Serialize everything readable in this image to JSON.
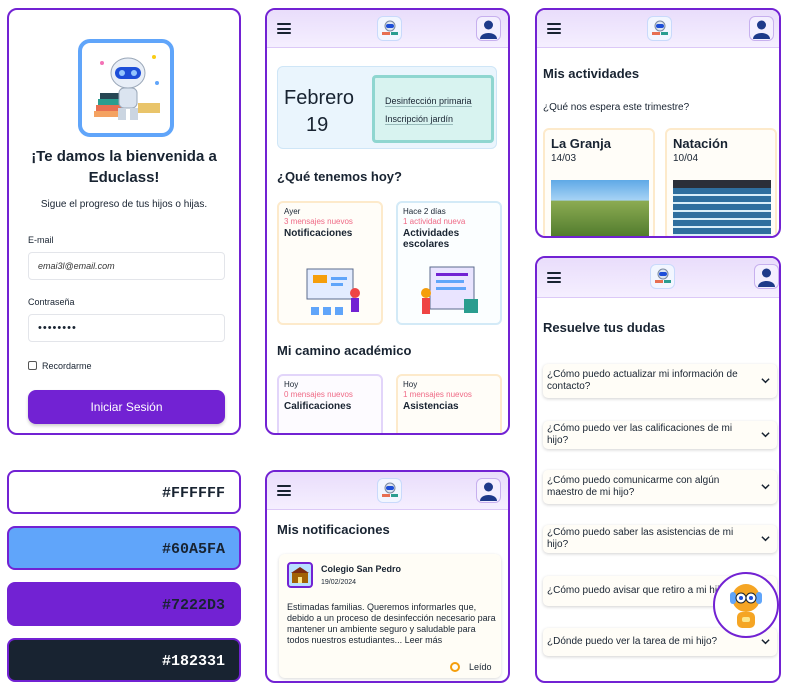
{
  "login": {
    "welcome": "¡Te damos la bienvenida a Educlass!",
    "subtitle": "Sigue el progreso de tus hijos o hijas.",
    "email_label": "E-mail",
    "email_value": "emai3l@email.com",
    "password_label": "Contraseña",
    "password_value": "••••••••",
    "remember_label": "Recordarme",
    "login_button": "Iniciar Sesión"
  },
  "palette": [
    {
      "hex": "#FFFFFF"
    },
    {
      "hex": "#60A5FA"
    },
    {
      "hex": "#7222D3"
    },
    {
      "hex": "#182331"
    }
  ],
  "home": {
    "month": "Febrero",
    "day": "19",
    "events": [
      "Desinfección primaria",
      "Inscripción jardín"
    ],
    "today_heading": "¿Qué tenemos hoy?",
    "cards": [
      {
        "when": "Ayer",
        "count": "3 mensajes nuevos",
        "title": "Notificaciones"
      },
      {
        "when": "Hace 2 días",
        "count": "1 actividad nueva",
        "title": "Actividades escolares"
      }
    ],
    "academic_heading": "Mi camino académico",
    "academic_cards": [
      {
        "when": "Hoy",
        "count": "0 mensajes nuevos",
        "title": "Calificaciones"
      },
      {
        "when": "Hoy",
        "count": "1 mensajes nuevos",
        "title": "Asistencias"
      }
    ]
  },
  "notifications": {
    "heading": "Mis notificaciones",
    "item": {
      "school": "Colegio San Pedro",
      "date": "19/02/2024",
      "body": "Estimadas familias. Queremos informarles que, debido a un proceso de desinfección necesario para mantener un ambiente seguro y saludable para todos nuestros estudiantes...",
      "more": "Leer más",
      "read_label": "Leído"
    }
  },
  "activities": {
    "heading": "Mis actividades",
    "question": "¿Qué nos espera este trimestre?",
    "items": [
      {
        "title": "La Granja",
        "date": "14/03"
      },
      {
        "title": "Natación",
        "date": "10/04"
      }
    ]
  },
  "faq": {
    "heading": "Resuelve tus dudas",
    "questions": [
      "¿Cómo puedo actualizar mi información de contacto?",
      "¿Cómo puedo ver las calificaciones de mi hijo?",
      "¿Cómo puedo comunicarme con algún maestro de mi hijo?",
      "¿Cómo puedo saber las asistencias de mi hijo?",
      "¿Cómo puedo avisar que retiro a mi hijo?",
      "¿Dónde puedo ver la tarea de mi hijo?"
    ]
  },
  "colors": {
    "primary": "#7222D3",
    "accent": "#60A5FA",
    "dark": "#182331",
    "white": "#FFFFFF",
    "pink_counter": "#EF6A86"
  },
  "icons": [
    "menu-icon",
    "logo-icon",
    "user-icon",
    "chevron-down-icon",
    "robot-assistant-icon"
  ]
}
